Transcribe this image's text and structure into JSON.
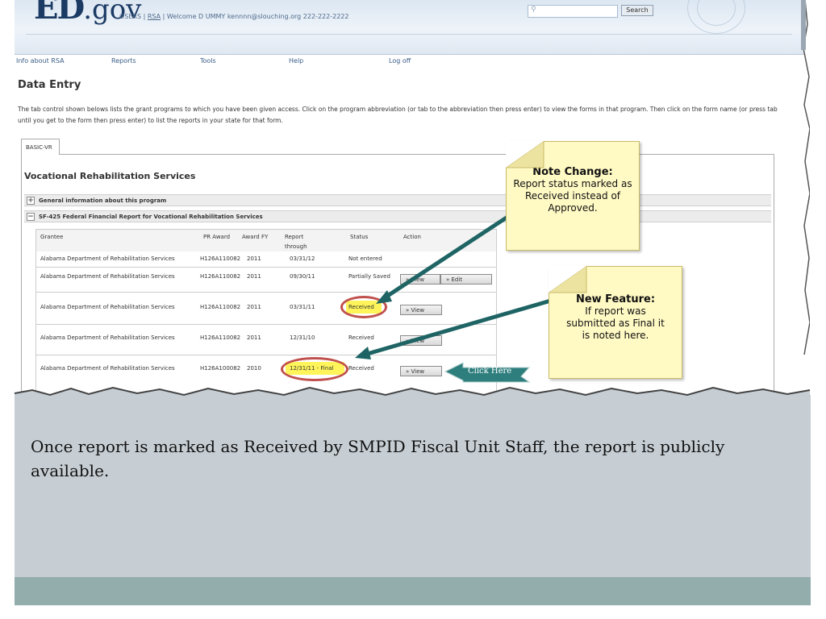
{
  "header": {
    "logo_bold": "ED",
    "logo_rest": ".gov",
    "links_prefix": "OSERS | ",
    "rsa_link": "RSA",
    "welcome": " | Welcome D UMMY kennnn@slouching.org 222-222-2222",
    "search_button": "Search"
  },
  "nav": {
    "items": [
      "Info about RSA",
      "Reports",
      "Tools",
      "Help",
      "Log off"
    ]
  },
  "page": {
    "title": "Data Entry",
    "intro": "The tab control shown belows lists the grant programs to which you have been given access. Click on the program abbreviation (or tab to the abbreviation then press enter) to view the forms in that program. Then click on the form name (or press tab until you get to the form then press enter) to list the reports in your state for that form.",
    "tab": "BASIC-VR",
    "section_title": "Vocational Rehabilitation Services"
  },
  "accordion": [
    {
      "symbol": "+",
      "label": "General information about this program"
    },
    {
      "symbol": "−",
      "label": "SF-425 Federal Financial Report for Vocational Rehabilitation Services"
    }
  ],
  "table": {
    "headers": {
      "grantee": "Grantee",
      "award": "PR Award",
      "fy": "Award FY",
      "report_line1": "Report",
      "report_line2": "through",
      "status": "Status",
      "action": "Action"
    },
    "rows": [
      {
        "grantee": "Alabama Department of Rehabilitation Services",
        "award": "H126A110082",
        "fy": "2011",
        "through": "03/31/12",
        "status": "Not entered"
      },
      {
        "grantee": "Alabama Department of Rehabilitation Services",
        "award": "H126A110082",
        "fy": "2011",
        "through": "09/30/11",
        "status": "Partially Saved"
      },
      {
        "grantee": "Alabama Department of Rehabilitation Services",
        "award": "H126A110082",
        "fy": "2011",
        "through": "03/31/11",
        "status": "Received"
      },
      {
        "grantee": "Alabama Department of Rehabilitation Services",
        "award": "H126A110082",
        "fy": "2011",
        "through": "12/31/10",
        "status": "Received"
      },
      {
        "grantee": "Alabama Department of Rehabilitation Services",
        "award": "H126A100082",
        "fy": "2010",
        "through": "12/31/11 - Final",
        "status": "Received"
      }
    ],
    "view_label": "» View",
    "edit_label": "» Edit"
  },
  "callouts": {
    "note_title": "Note Change:",
    "note_body": "Report status marked as Received instead of Approved.",
    "feature_title": "New Feature:",
    "feature_body": "If report was submitted as Final it is noted here.",
    "click_here": "Click Here"
  },
  "slide": {
    "caption": "Once report is marked as Received by SMPID Fiscal Unit Staff, the report is publicly available."
  },
  "colors": {
    "highlight": "#fff55a",
    "ellipse": "#c0504d",
    "arrow": "#1f6464",
    "note_bg": "#fff9c4",
    "slide_body": "#c6ced4",
    "slide_footer": "#93adad"
  }
}
